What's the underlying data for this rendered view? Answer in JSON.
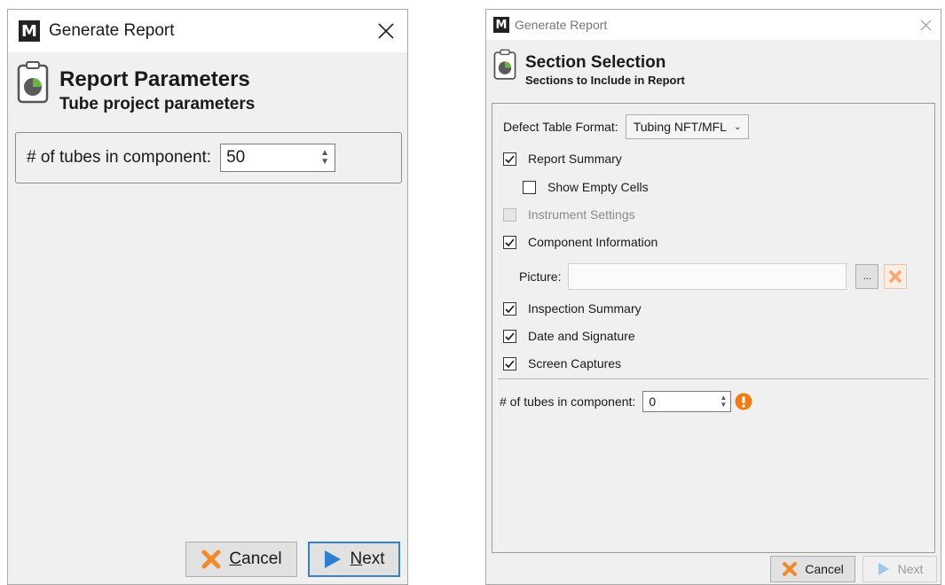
{
  "left_dialog": {
    "title": "Generate Report",
    "header": {
      "title": "Report Parameters",
      "subtitle": "Tube project parameters"
    },
    "tubes": {
      "label": "# of tubes in component:",
      "value": "50"
    },
    "buttons": {
      "cancel_u": "C",
      "cancel_rest": "ancel",
      "next_u": "N",
      "next_rest": "ext"
    }
  },
  "right_dialog": {
    "title": "Generate Report",
    "header": {
      "title": "Section Selection",
      "subtitle": "Sections to Include in Report"
    },
    "defect_table": {
      "label": "Defect Table Format:",
      "value": "Tubing NFT/MFL"
    },
    "sections": {
      "report_summary": {
        "label": "Report Summary",
        "checked": true
      },
      "show_empty_cells": {
        "label": "Show Empty Cells",
        "checked": false
      },
      "instrument_settings": {
        "label": "Instrument Settings",
        "checked": false,
        "enabled": false
      },
      "component_information": {
        "label": "Component Information",
        "checked": true
      },
      "inspection_summary": {
        "label": "Inspection Summary",
        "checked": true
      },
      "date_and_signature": {
        "label": "Date and Signature",
        "checked": true
      },
      "screen_captures": {
        "label": "Screen Captures",
        "checked": true
      }
    },
    "picture": {
      "label": "Picture:",
      "value": "",
      "browse_label": "..."
    },
    "tubes": {
      "label": "# of tubes in component:",
      "value": "0"
    },
    "buttons": {
      "cancel": "Cancel",
      "next": "Next"
    }
  },
  "colors": {
    "accent_blue": "#2f7fd1",
    "cancel_orange": "#f08a2c",
    "warning_orange": "#f07c14",
    "icon_green": "#6db33f"
  }
}
